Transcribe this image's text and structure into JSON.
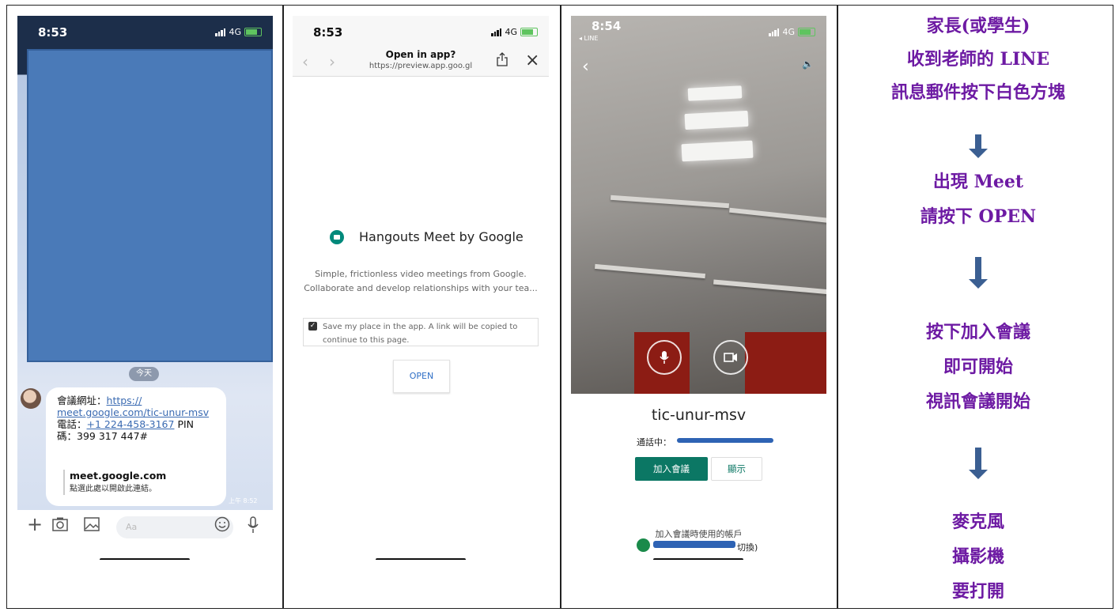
{
  "line_chat": {
    "status_time": "8:53",
    "network": "4G",
    "today_label": "今天",
    "message": {
      "url_label": "會議網址：",
      "url_part1": "https://",
      "url_part2": "meet.google.com/tic-unur-msv",
      "phone_label": "電話：",
      "phone_number": "+1 224-458-3167",
      "pin_label": " PIN",
      "pin_line": "碼：399 317 447#",
      "preview_title": "meet.google.com",
      "preview_subtitle": "點選此處以開啟此連結。",
      "timestamp": "上午 8:52"
    },
    "input_placeholder": "Aa"
  },
  "open_in_app": {
    "status_time": "8:53",
    "network": "4G",
    "nav_title": "Open in app?",
    "nav_url": "https://preview.app.goo.gl",
    "app_name": "Hangouts Meet by Google",
    "description_line1": "Simple, frictionless video meetings from Google.",
    "description_line2": "Collaborate and develop relationships with your tea...",
    "save_line1": "Save my place in the app. A link will be copied to",
    "save_line2": "continue to this page.",
    "open_button": "OPEN"
  },
  "meet_join": {
    "status_time": "8:54",
    "network": "4G",
    "back_app": "◂ LINE",
    "meeting_code": "tic-unur-msv",
    "in_call_label": "通話中：",
    "join_button": "加入會議",
    "present_button": "顯示",
    "account_label": "加入會議時使用的帳戶",
    "switch_label": "切換)"
  },
  "instructions": {
    "step1": [
      "家長(或學生)",
      "收到老師的 LINE",
      "訊息郵件按下白色方塊"
    ],
    "step2": [
      "出現 Meet",
      "請按下 OPEN"
    ],
    "step3": [
      "按下加入會議",
      "即可開始",
      "視訊會議開始"
    ],
    "step4": [
      "麥克風",
      "攝影機",
      "要打開"
    ],
    "text_color": "#6d1aa3",
    "arrow_color": "#3b5f92"
  }
}
